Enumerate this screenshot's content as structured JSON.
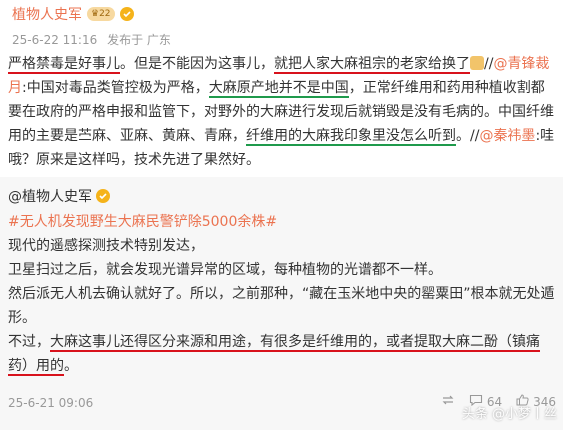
{
  "post": {
    "username": "植物人史军",
    "badge": "22",
    "date": "25-6-22 11:16",
    "via": "发布于 广东",
    "text": {
      "p1": "严格禁毒是好事儿",
      "p2": "。但是不能因为这事儿，",
      "p3": "就把人家大麻祖宗的老家给换了",
      "p4": "//",
      "mention1": "@青锋裁月",
      "p5": ":中国对毒品类管控极为严格，",
      "p6": "大麻原产地并不是中国",
      "p7": "，正常纤维用和药用种植收割都要在政府的严格申报和监管下，对野外的大麻进行发现后就销毁是没有毛病的。中国纤维用的主要是苎麻、亚麻、黄麻、青麻，",
      "p8": "纤维用的大麻我印象里没怎么听到",
      "p9": "。//",
      "mention2": "@秦祎墨",
      "p10": ":哇哦？原来是这样吗，技术先进了果然好。"
    }
  },
  "repost": {
    "username": "@植物人史军",
    "topic": "#无人机发现野生大麻民警铲除5000余株#",
    "lines": [
      "现代的遥感探测技术特别发达，",
      "卫星扫过之后，就会发现光谱异常的区域，每种植物的光谱都不一样。",
      "然后派无人机去确认就好了。所以，之前那种，“藏在玉米地中央的罂粟田”根本就无处遁形。"
    ],
    "last_prefix": "不过，",
    "last_underline": "大麻这事儿还得区分来源和用途，有很多是纤维用的，或者提取大麻二酚（镇痛药）用的",
    "last_suffix": "。",
    "date": "25-6-21 09:06",
    "comments": "64",
    "likes": "346"
  },
  "watermark": "头条 @小梦丨丝",
  "icons": [
    "vip-crown-icon",
    "verified-icon",
    "emoji-dog-icon",
    "repost-icon",
    "comment-icon",
    "like-icon"
  ]
}
